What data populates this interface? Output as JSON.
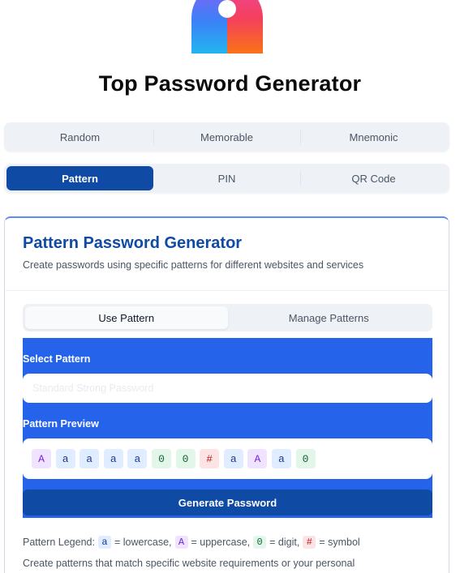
{
  "app": {
    "title": "Top Password Generator"
  },
  "mode_tabs_row1": [
    {
      "label": "Random",
      "active": false
    },
    {
      "label": "Memorable",
      "active": false
    },
    {
      "label": "Mnemonic",
      "active": false
    }
  ],
  "mode_tabs_row2": [
    {
      "label": "Pattern",
      "active": true
    },
    {
      "label": "PIN",
      "active": false
    },
    {
      "label": "QR Code",
      "active": false
    }
  ],
  "card": {
    "title": "Pattern Password Generator",
    "subtitle": "Create passwords using specific patterns for different websites and services",
    "inner_tabs": [
      {
        "label": "Use Pattern",
        "active": true
      },
      {
        "label": "Manage Patterns",
        "active": false
      }
    ],
    "select_pattern_label": "Select Pattern",
    "select_pattern_value": "Standard Strong Password",
    "pattern_preview_label": "Pattern Preview",
    "pattern_preview": [
      {
        "char": "A",
        "kind": "upper"
      },
      {
        "char": "a",
        "kind": "lower"
      },
      {
        "char": "a",
        "kind": "lower"
      },
      {
        "char": "a",
        "kind": "lower"
      },
      {
        "char": "a",
        "kind": "lower"
      },
      {
        "char": "0",
        "kind": "digit"
      },
      {
        "char": "0",
        "kind": "digit"
      },
      {
        "char": "#",
        "kind": "symbol"
      },
      {
        "char": "a",
        "kind": "lower"
      },
      {
        "char": "A",
        "kind": "upper"
      },
      {
        "char": "a",
        "kind": "lower"
      },
      {
        "char": "0",
        "kind": "digit"
      }
    ],
    "generate_label": "Generate Password",
    "legend": {
      "prefix": "Pattern Legend:",
      "items": [
        {
          "char": "a",
          "kind": "lower",
          "text": "= lowercase,"
        },
        {
          "char": "A",
          "kind": "upper",
          "text": "= uppercase,"
        },
        {
          "char": "0",
          "kind": "digit",
          "text": "= digit,"
        },
        {
          "char": "#",
          "kind": "symbol",
          "text": "= symbol"
        }
      ]
    },
    "note": "Create patterns that match specific website requirements or your personal"
  },
  "colors": {
    "primary": "#0f4aa5",
    "panel": "#2563eb",
    "lower_chip": "#e0ecff",
    "upper_chip": "#efe3ff",
    "digit_chip": "#e3f6ea",
    "symbol_chip": "#fde4e4"
  }
}
